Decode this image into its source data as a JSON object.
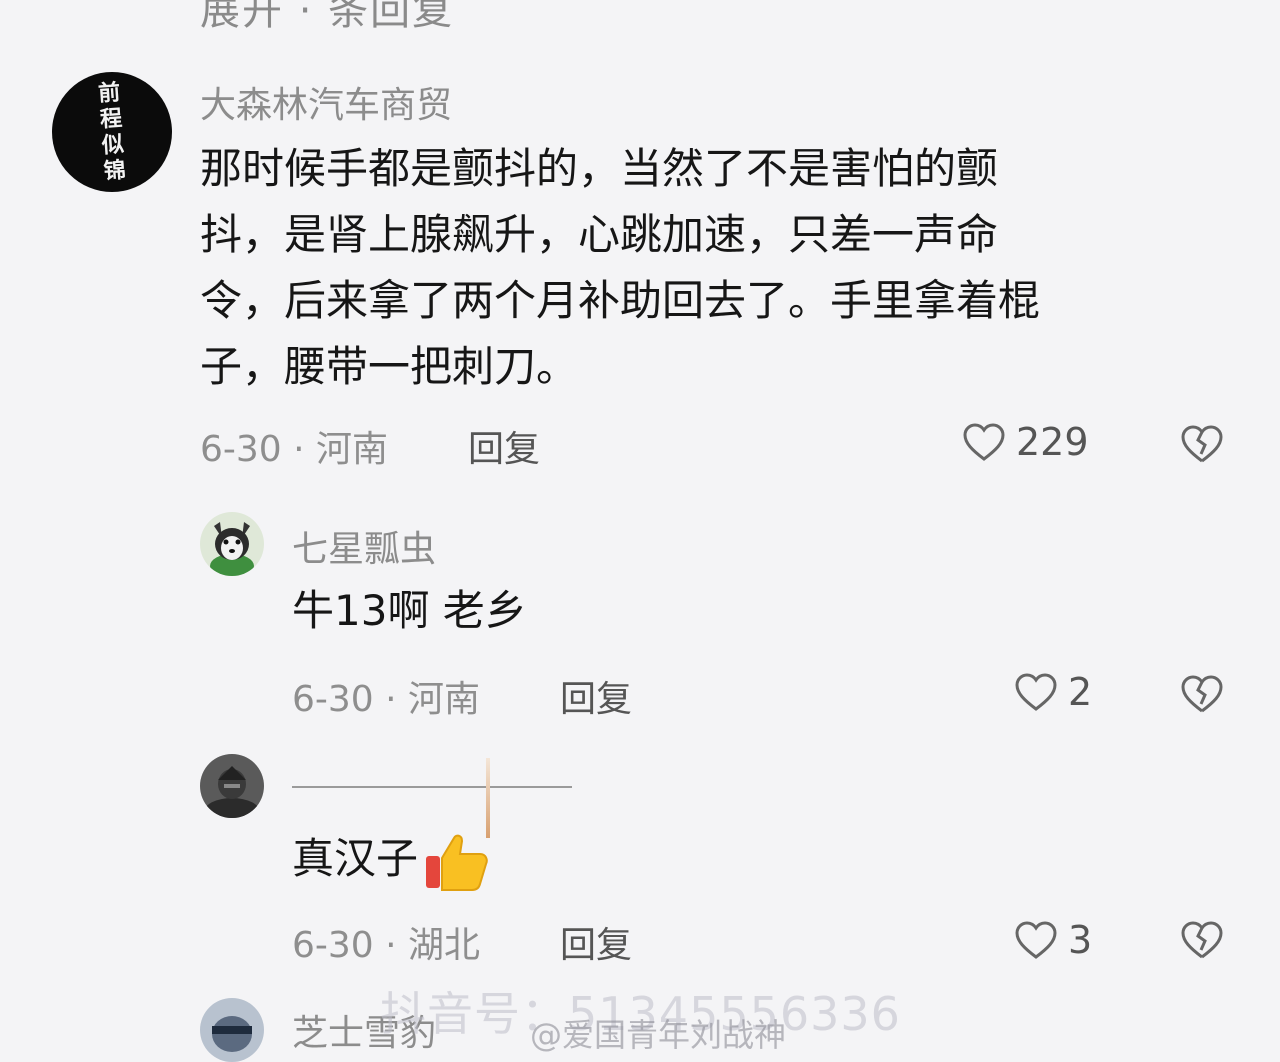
{
  "top_partial_text": "展开 · 条回复",
  "comments": [
    {
      "username": "大森林汽车商贸",
      "avatar_text": "前程似锦",
      "text": "那时候手都是颤抖的，当然了不是害怕的颤抖，是肾上腺飙升，心跳加速，只差一声命令，后来拿了两个月补助回去了。手里拿着棍子，腰带一把刺刀。",
      "lines": [
        "那时候手都是颤抖的，当然了不是害怕的颤",
        "抖，是肾上腺飙升，心跳加速，只差一声命",
        "令，后来拿了两个月补助回去了。手里拿着棍",
        "子，腰带一把刺刀。"
      ],
      "date_location": "6-30 · 河南",
      "reply_label": "回复",
      "likes": "229"
    },
    {
      "username": "七星瓢虫",
      "text": "牛13啊 老乡",
      "date_location": "6-30 · 河南",
      "reply_label": "回复",
      "likes": "2"
    },
    {
      "username": "",
      "text": "真汉子",
      "emoji": "thumbs-up",
      "date_location": "6-30 · 湖北",
      "reply_label": "回复",
      "likes": "3"
    },
    {
      "username": "芝士雪豹"
    }
  ],
  "watermark": {
    "main": "抖音号：51345556336",
    "weibo": "@爱国青年刘战神"
  },
  "colors": {
    "background": "#f4f4f6",
    "username": "#8c8c8c",
    "text": "#161616"
  }
}
